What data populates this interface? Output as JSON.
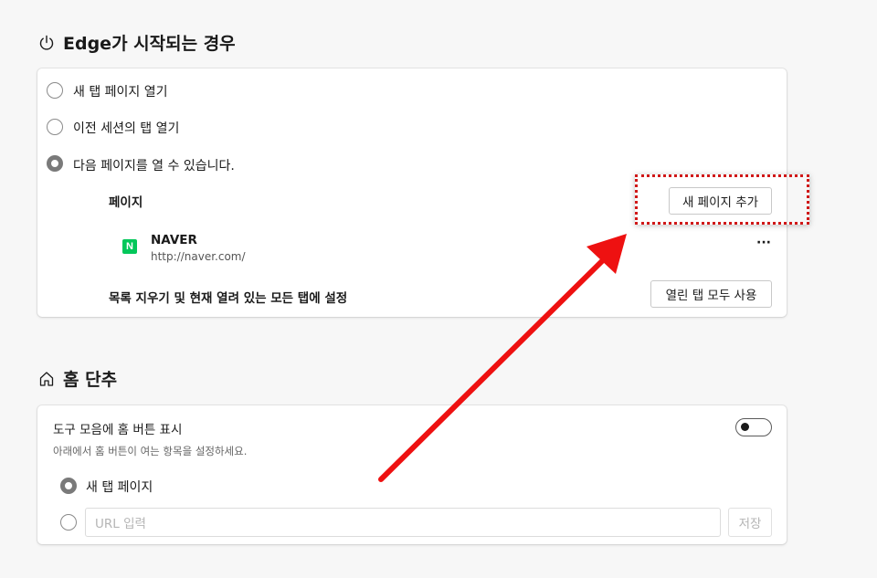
{
  "startup": {
    "title": "Edge가 시작되는 경우",
    "options": [
      {
        "label": "새 탭 페이지 열기",
        "checked": false
      },
      {
        "label": "이전 세션의 탭 열기",
        "checked": false
      },
      {
        "label": "다음 페이지를 열 수 있습니다.",
        "checked": true
      }
    ],
    "pages_heading": "페이지",
    "add_page_button": "새 페이지 추가",
    "pages": [
      {
        "name": "NAVER",
        "url": "http://naver.com/",
        "favicon": "N"
      }
    ],
    "more_label": "···",
    "clear_label": "목록 지우기 및 현재 열려 있는 모든 탭에 설정",
    "use_open_tabs_button": "열린 탭 모두 사용"
  },
  "home": {
    "title": "홈 단추",
    "toggle_label": "도구 모음에 홈 버튼 표시",
    "toggle_description": "아래에서 홈 버튼이 여는 항목을 설정하세요.",
    "toggle_on": false,
    "new_tab_option": "새 탭 페이지",
    "url_placeholder": "URL 입력",
    "save_button": "저장"
  },
  "annotation": {
    "highlight_color": "#d01818",
    "arrow_color": "#ee1111"
  }
}
